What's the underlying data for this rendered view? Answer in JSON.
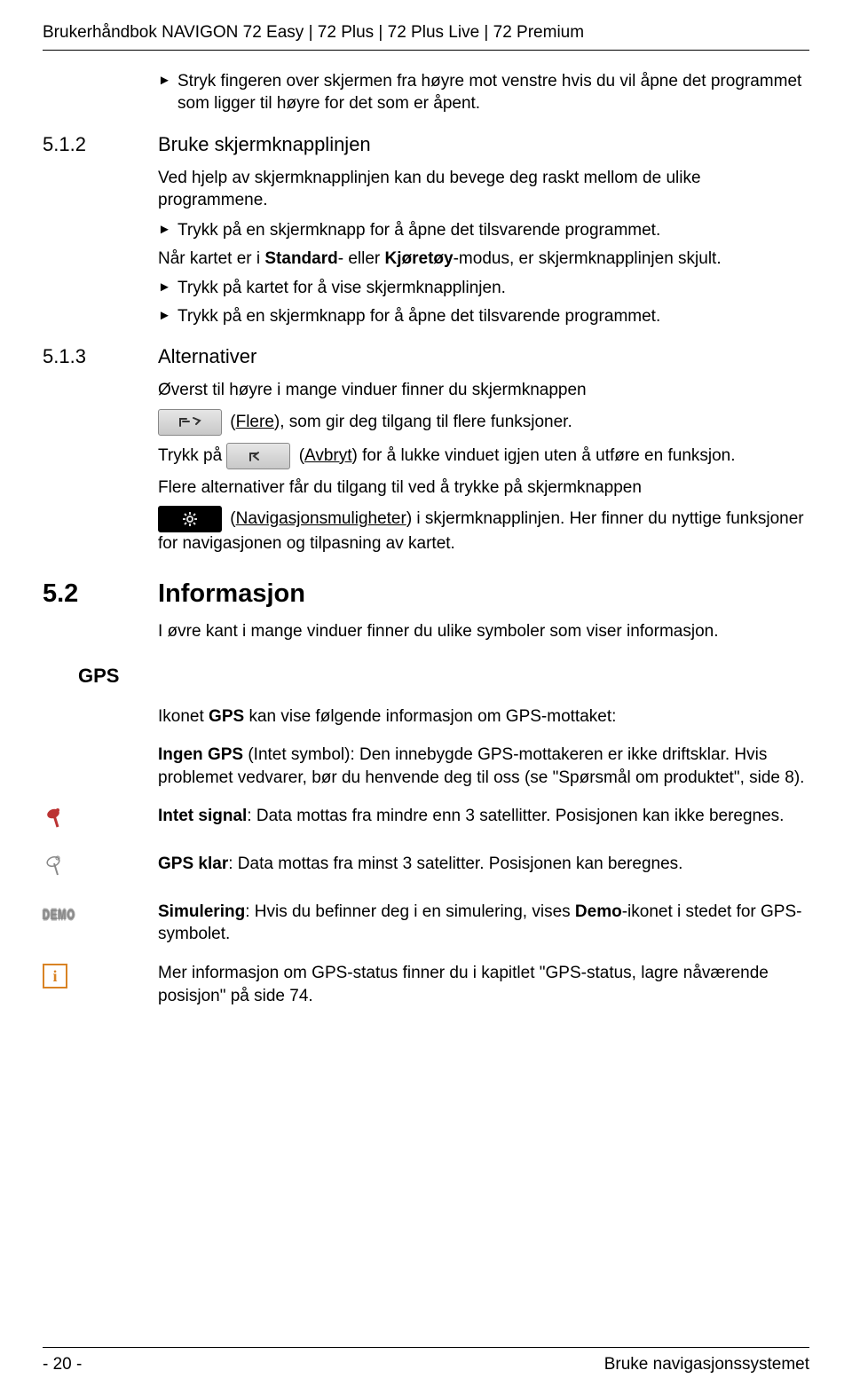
{
  "header": "Brukerhåndbok NAVIGON 72 Easy | 72 Plus | 72 Plus Live | 72 Premium",
  "intro_bullet": "Stryk fingeren over skjermen fra høyre mot venstre hvis du vil åpne det programmet som ligger til høyre for det som er åpent.",
  "s512": {
    "num": "5.1.2",
    "title": "Bruke skjermknapplinjen",
    "p1": "Ved hjelp av skjermknapplinjen kan du bevege deg raskt mellom de ulike programmene.",
    "b1": "Trykk på en skjermknapp for å åpne det tilsvarende programmet.",
    "p2_pre": "Når kartet er i ",
    "p2_bold1": "Standard",
    "p2_mid": "- eller ",
    "p2_bold2": "Kjøretøy",
    "p2_post": "-modus, er skjermknapplinjen skjult.",
    "b2": "Trykk på kartet for å vise skjermknapplinjen.",
    "b3": "Trykk på en skjermknapp for å åpne det tilsvarende programmet."
  },
  "s513": {
    "num": "5.1.3",
    "title": "Alternativer",
    "p1": "Øverst til høyre i mange vinduer finner du skjermknappen",
    "flere_label": "Flere",
    "flere_post": "), som gir deg tilgang til flere funksjoner.",
    "trykk_pa": "Trykk på ",
    "avbryt_label": "Avbryt",
    "avbryt_post": ") for å lukke vinduet igjen uten å utføre en funksjon.",
    "p2": "Flere alternativer får du tilgang til ved å trykke på skjermknappen",
    "nav_label": "Navigasjonsmuligheter",
    "nav_post": ") i skjermknapplinjen. Her finner du nyttige funksjoner for navigasjonen og tilpasning av kartet."
  },
  "s52": {
    "num": "5.2",
    "title": "Informasjon",
    "p1": "I øvre kant i mange vinduer finner du ulike symboler som viser informasjon."
  },
  "gps": {
    "heading": "GPS",
    "intro_pre": "Ikonet ",
    "intro_bold": "GPS",
    "intro_post": " kan vise følgende informasjon om GPS-mottaket:",
    "no_gps_bold": "Ingen GPS",
    "no_gps_text": " (Intet symbol): Den innebygde GPS-mottakeren er ikke driftsklar. Hvis problemet vedvarer, bør du henvende deg til oss (se \"Spørsmål om produktet\", side 8).",
    "no_signal_bold": "Intet signal",
    "no_signal_text": ": Data mottas fra mindre enn 3 satellitter. Posisjonen kan ikke beregnes.",
    "ready_bold": "GPS klar",
    "ready_text": ": Data mottas fra minst 3 satelitter. Posisjonen kan beregnes.",
    "sim_bold1": "Simulering",
    "sim_mid": ": Hvis du befinner deg i en simulering, vises ",
    "sim_bold2": "Demo",
    "sim_post": "-ikonet i stedet for GPS-symbolet.",
    "info_text": "Mer informasjon om GPS-status finner du i kapitlet \"GPS-status, lagre nåværende posisjon\" på side 74."
  },
  "footer": {
    "page": "- 20 -",
    "section": "Bruke navigasjonssystemet"
  }
}
